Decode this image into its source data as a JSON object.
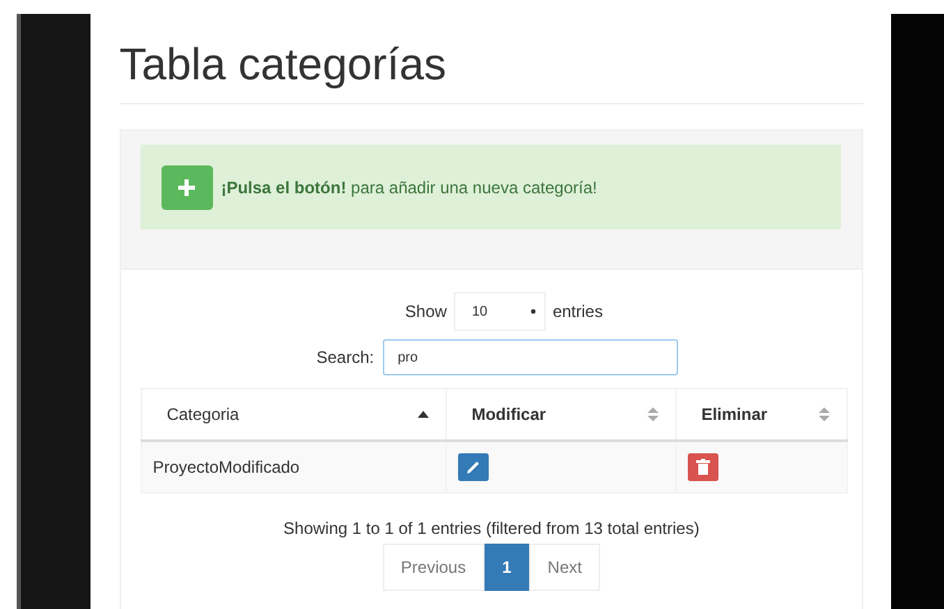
{
  "title": "Tabla categorías",
  "alert": {
    "text": "**¡Pulsa el botón!** para añadir una nueva categoría!"
  },
  "length": {
    "label_before": "Show",
    "value": "10",
    "label_after": "entries"
  },
  "search": {
    "label": "Search:",
    "value": "pro"
  },
  "table": {
    "columns": [
      {
        "label": "Categoria",
        "sorted_ascending": true
      },
      {
        "label": "Modificar",
        "sorted_ascending": false
      },
      {
        "label": "Eliminar",
        "sorted_ascending": false
      }
    ],
    "rows": [
      {
        "name": "ProyectoModificado"
      }
    ]
  },
  "info": "Showing 1 to 1 of 1 entries (filtered from 13 total entries)",
  "pagination": [
    {
      "label": "Previous",
      "disabled": true,
      "selected": false
    },
    {
      "label": "1",
      "disabled": false,
      "selected": true
    },
    {
      "label": "Next",
      "disabled": true,
      "selected": false
    }
  ]
}
